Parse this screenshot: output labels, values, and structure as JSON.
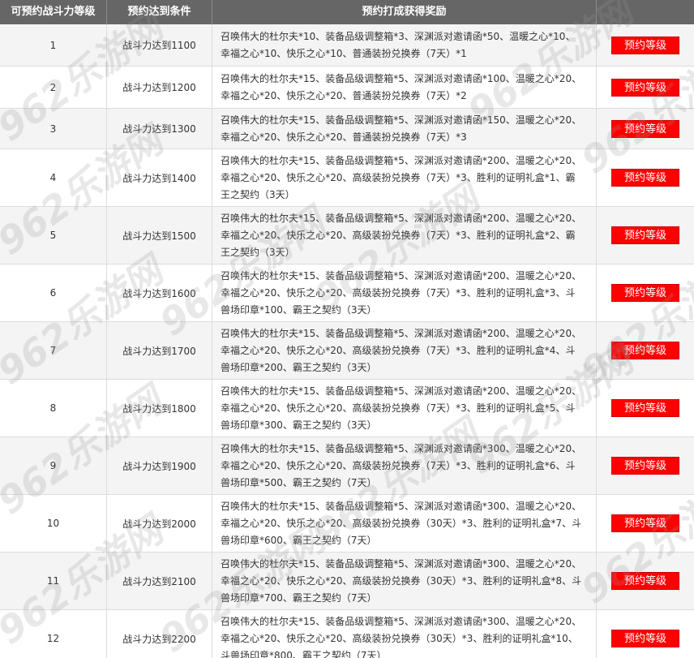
{
  "headers": {
    "level": "可预约战斗力等级",
    "condition": "预约达到条件",
    "reward": "预约打成获得奖励",
    "action": ""
  },
  "button_label": "预约等级",
  "colors": {
    "header_bg": "#666666",
    "button_bg": "#ff0000",
    "row_alt": "#f4f4f4"
  },
  "watermark": "962乐游网",
  "rows": [
    {
      "level": "1",
      "condition": "战斗力达到1100",
      "reward": "召唤伟大的杜尔夫*10、装备品级调整箱*3、深渊派对邀请函*50、温暖之心*10、幸福之心*10、快乐之心*10、普通装扮兑换券（7天）*1"
    },
    {
      "level": "2",
      "condition": "战斗力达到1200",
      "reward": "召唤伟大的杜尔夫*15、装备品级调整箱*5、深渊派对邀请函*100、温暖之心*20、幸福之心*20、快乐之心*20、普通装扮兑换券（7天）*2"
    },
    {
      "level": "3",
      "condition": "战斗力达到1300",
      "reward": "召唤伟大的杜尔夫*15、装备品级调整箱*5、深渊派对邀请函*150、温暖之心*20、幸福之心*20、快乐之心*20、普通装扮兑换券（7天）*3"
    },
    {
      "level": "4",
      "condition": "战斗力达到1400",
      "reward": "召唤伟大的杜尔夫*15、装备品级调整箱*5、深渊派对邀请函*200、温暖之心*20、幸福之心*20、快乐之心*20、高级装扮兑换券（7天）*3、胜利的证明礼盒*1、霸王之契约（3天）"
    },
    {
      "level": "5",
      "condition": "战斗力达到1500",
      "reward": "召唤伟大的杜尔夫*15、装备品级调整箱*5、深渊派对邀请函*200、温暖之心*20、幸福之心*20、快乐之心*20、高级装扮兑换券（7天）*3、胜利的证明礼盒*2、霸王之契约（3天）"
    },
    {
      "level": "6",
      "condition": "战斗力达到1600",
      "reward": "召唤伟大的杜尔夫*15、装备品级调整箱*5、深渊派对邀请函*200、温暖之心*20、幸福之心*20、快乐之心*20、高级装扮兑换券（7天）*3、胜利的证明礼盒*3、斗兽场印章*100、霸王之契约（3天）"
    },
    {
      "level": "7",
      "condition": "战斗力达到1700",
      "reward": "召唤伟大的杜尔夫*15、装备品级调整箱*5、深渊派对邀请函*200、温暖之心*20、幸福之心*20、快乐之心*20、高级装扮兑换券（7天）*3、胜利的证明礼盒*4、斗兽场印章*200、霸王之契约（3天）"
    },
    {
      "level": "8",
      "condition": "战斗力达到1800",
      "reward": "召唤伟大的杜尔夫*15、装备品级调整箱*5、深渊派对邀请函*200、温暖之心*20、幸福之心*20、快乐之心*20、高级装扮兑换券（7天）*3、胜利的证明礼盒*5、斗兽场印章*300、霸王之契约（3天）"
    },
    {
      "level": "9",
      "condition": "战斗力达到1900",
      "reward": "召唤伟大的杜尔夫*15、装备品级调整箱*5、深渊派对邀请函*300、温暖之心*20、幸福之心*20、快乐之心*20、高级装扮兑换券（7天）*3、胜利的证明礼盒*6、斗兽场印章*500、霸王之契约（7天）"
    },
    {
      "level": "10",
      "condition": "战斗力达到2000",
      "reward": "召唤伟大的杜尔夫*15、装备品级调整箱*5、深渊派对邀请函*300、温暖之心*20、幸福之心*20、快乐之心*20、高级装扮兑换券（30天）*3、胜利的证明礼盒*7、斗兽场印章*600、霸王之契约（7天）"
    },
    {
      "level": "11",
      "condition": "战斗力达到2100",
      "reward": "召唤伟大的杜尔夫*15、装备品级调整箱*5、深渊派对邀请函*300、温暖之心*20、幸福之心*20、快乐之心*20、高级装扮兑换券（30天）*3、胜利的证明礼盒*8、斗兽场印章*700、霸王之契约（7天）"
    },
    {
      "level": "12",
      "condition": "战斗力达到2200",
      "reward": "召唤伟大的杜尔夫*15、装备品级调整箱*5、深渊派对邀请函*300、温暖之心*20、幸福之心*20、快乐之心*20、高级装扮兑换券（30天）*3、胜利的证明礼盒*10、斗兽场印章*800、霸王之契约（7天）"
    }
  ]
}
